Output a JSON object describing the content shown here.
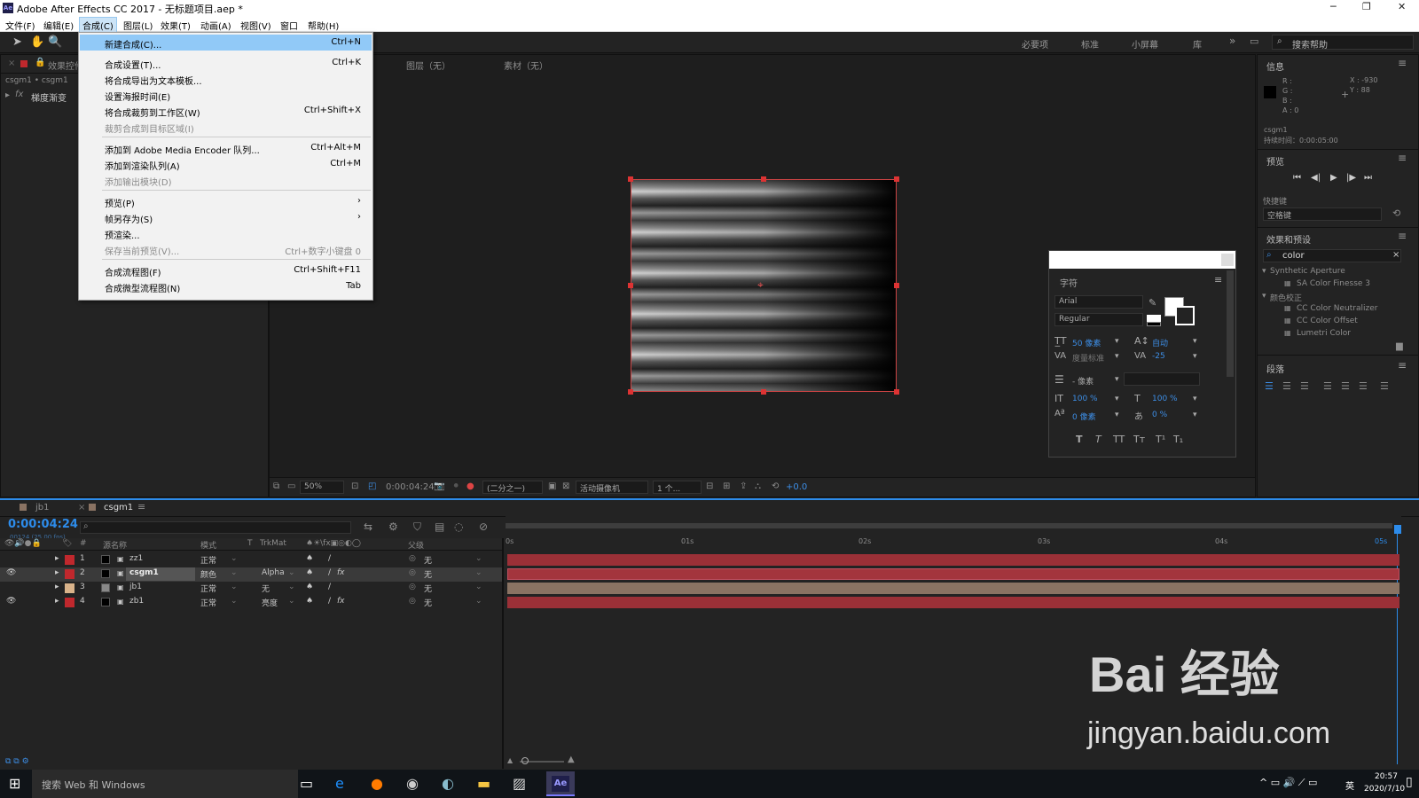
{
  "window": {
    "title": "Adobe After Effects CC 2017 - 无标题项目.aep *",
    "logo": "Ae"
  },
  "menubar": [
    "文件(F)",
    "编辑(E)",
    "合成(C)",
    "图层(L)",
    "效果(T)",
    "动画(A)",
    "视图(V)",
    "窗口",
    "帮助(H)"
  ],
  "workspaces": [
    "必要项",
    "标准",
    "小屏幕",
    "库",
    "»"
  ],
  "help_search": {
    "placeholder": "搜索帮助"
  },
  "dropdown": [
    {
      "label": "新建合成(C)...",
      "shortcut": "Ctrl+N",
      "state": "highlight"
    },
    {
      "label": "合成设置(T)...",
      "shortcut": "Ctrl+K",
      "state": "normal"
    },
    {
      "label": "将合成导出为文本模板...",
      "shortcut": "",
      "state": "normal"
    },
    {
      "label": "设置海报时间(E)",
      "shortcut": "",
      "state": "normal"
    },
    {
      "label": "将合成裁剪到工作区(W)",
      "shortcut": "Ctrl+Shift+X",
      "state": "normal"
    },
    {
      "label": "裁剪合成到目标区域(I)",
      "shortcut": "",
      "state": "disabled"
    },
    {
      "label": "添加到 Adobe Media Encoder 队列...",
      "shortcut": "Ctrl+Alt+M",
      "state": "normal"
    },
    {
      "label": "添加到渲染队列(A)",
      "shortcut": "Ctrl+M",
      "state": "normal"
    },
    {
      "label": "添加输出模块(D)",
      "shortcut": "",
      "state": "disabled"
    },
    {
      "label": "预览(P)",
      "shortcut": "›",
      "state": "normal"
    },
    {
      "label": "帧另存为(S)",
      "shortcut": "›",
      "state": "normal"
    },
    {
      "label": "预渲染...",
      "shortcut": "",
      "state": "normal"
    },
    {
      "label": "保存当前预览(V)...",
      "shortcut": "Ctrl+数字小键盘 0",
      "state": "disabled"
    },
    {
      "label": "合成流程图(F)",
      "shortcut": "Ctrl+Shift+F11",
      "state": "normal"
    },
    {
      "label": "合成微型流程图(N)",
      "shortcut": "Tab",
      "state": "normal"
    }
  ],
  "effects_panel": {
    "tab": "效果控件",
    "breadcrumb": "csgm1 • csgm1",
    "effect": "梯度渐变",
    "fx": "fx"
  },
  "viewer": {
    "tabs": [
      "图层（无）",
      "素材（无）"
    ],
    "zoom": "50%",
    "timecode": "0:00:04:24",
    "resolution": "(二分之一)",
    "camera": "活动摄像机",
    "views": "1 个...",
    "exposure": "+0.0"
  },
  "info": {
    "title": "信息",
    "r": "R :",
    "g": "G :",
    "b": "B :",
    "a": "A : 0",
    "x": "X : -930",
    "y": "Y : 88",
    "layer": "csgm1",
    "duration": "持续时间：0:00:05:00"
  },
  "preview": {
    "title": "预览",
    "shortcut_label": "快捷键",
    "shortcut_value": "空格键"
  },
  "effects_presets": {
    "title": "效果和预设",
    "search": "color",
    "groups": [
      {
        "name": "Synthetic Aperture",
        "items": [
          "SA Color Finesse 3"
        ]
      },
      {
        "name": "颜色校正",
        "items": [
          "CC Color Neutralizer",
          "CC Color Offset",
          "Lumetri Color"
        ]
      }
    ]
  },
  "paragraph": {
    "title": "段落"
  },
  "character": {
    "title": "字符",
    "font": "Arial",
    "style": "Regular",
    "size": "50 像素",
    "leading": "自动",
    "kerning": "度量标准",
    "tracking": "-25",
    "stroke": "- 像素",
    "vscale": "100 %",
    "hscale": "100 %",
    "baseline": "0 像素",
    "tsume": "0 %",
    "styles": [
      "T",
      "T",
      "TT",
      "Tт",
      "T¹",
      "T₁"
    ]
  },
  "timeline": {
    "tabs": [
      "jb1",
      "csgm1"
    ],
    "timecode": "0:00:04:24",
    "fps": "00124 (25.00 fps)",
    "columns": [
      "#",
      "源名称",
      "模式",
      "T",
      "TrkMat",
      "父级"
    ],
    "ruler": [
      "0s",
      "01s",
      "02s",
      "03s",
      "04s",
      "05s"
    ],
    "layers": [
      {
        "num": "1",
        "name": "zz1",
        "mode": "正常",
        "trkmat": "",
        "parent": "无",
        "color": "#c0282d",
        "bar": "#9b3037"
      },
      {
        "num": "2",
        "name": "csgm1",
        "mode": "颜色",
        "trkmat": "Alpha",
        "parent": "无",
        "color": "#c0282d",
        "bar": "#9b3037"
      },
      {
        "num": "3",
        "name": "jb1",
        "mode": "正常",
        "trkmat": "无",
        "parent": "无",
        "color": "#d9b38a",
        "bar": "#8a7363"
      },
      {
        "num": "4",
        "name": "zb1",
        "mode": "正常",
        "trkmat": "亮度",
        "parent": "无",
        "color": "#c0282d",
        "bar": "#9b3037"
      }
    ]
  },
  "watermark": {
    "brand": "Bai 经验",
    "url": "jingyan.baidu.com"
  },
  "taskbar": {
    "search": "搜索 Web 和 Windows",
    "time": "20:57",
    "date": "2020/7/10",
    "lang": "英"
  }
}
